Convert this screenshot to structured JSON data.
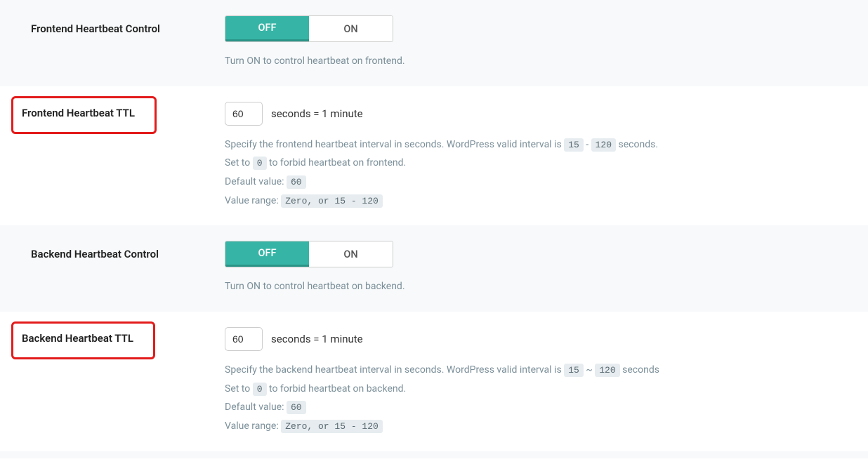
{
  "toggle": {
    "off": "OFF",
    "on": "ON"
  },
  "rows": [
    {
      "label": "Frontend Heartbeat Control",
      "hint": "Turn ON to control heartbeat on frontend."
    },
    {
      "label": "Frontend Heartbeat TTL",
      "value": "60",
      "suffix": "seconds = 1 minute",
      "line1_a": "Specify the frontend heartbeat interval in seconds. WordPress valid interval is ",
      "min": "15",
      "sep1": " - ",
      "max": "120",
      "line1_b": " seconds.",
      "line2_a": "Set to ",
      "zero": "0",
      "line2_b": " to forbid heartbeat on frontend.",
      "line3_a": "Default value: ",
      "default": "60",
      "line4_a": "Value range: ",
      "range": "Zero, or 15 - 120"
    },
    {
      "label": "Backend Heartbeat Control",
      "hint": "Turn ON to control heartbeat on backend."
    },
    {
      "label": "Backend Heartbeat TTL",
      "value": "60",
      "suffix": "seconds = 1 minute",
      "line1_a": "Specify the backend heartbeat interval in seconds. WordPress valid interval is ",
      "min": "15",
      "sep1": " ~ ",
      "max": "120",
      "line1_b": " seconds",
      "line2_a": "Set to ",
      "zero": "0",
      "line2_b": " to forbid heartbeat on backend.",
      "line3_a": "Default value: ",
      "default": "60",
      "line4_a": "Value range: ",
      "range": "Zero, or 15 - 120"
    }
  ]
}
